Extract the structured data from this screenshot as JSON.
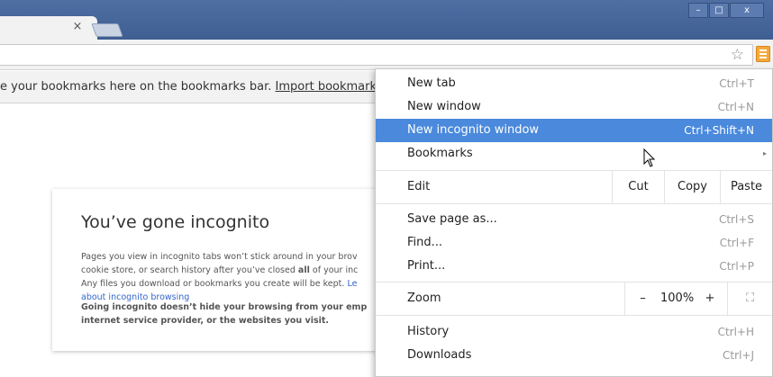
{
  "window": {
    "minimize": "–",
    "maximize": "□",
    "close": "x"
  },
  "tab": {
    "close": "×"
  },
  "bookmarks_bar": {
    "text": "e your bookmarks here on the bookmarks bar.",
    "import_link": "Import bookmark"
  },
  "incognito_page": {
    "title": "You’ve gone incognito",
    "para1_line1": "Pages you view in incognito tabs won’t stick around in your brov",
    "para1_line2": "cookie store, or search history after you’ve closed",
    "para1_bold": "all",
    "para1_line2b": "of your inc",
    "para1_line3": "Any files you download or bookmarks you create will be kept.",
    "para1_link1": "Le",
    "para1_link2": "about incognito browsing",
    "para2_line1": "Going incognito doesn’t hide your browsing from your emp",
    "para2_line2": "internet service provider, or the websites you visit."
  },
  "menu": {
    "new_tab": {
      "label": "New tab",
      "shortcut": "Ctrl+T"
    },
    "new_window": {
      "label": "New window",
      "shortcut": "Ctrl+N"
    },
    "new_incognito": {
      "label": "New incognito window",
      "shortcut": "Ctrl+Shift+N"
    },
    "bookmarks": {
      "label": "Bookmarks",
      "arrow": "▸"
    },
    "edit": {
      "label": "Edit",
      "cut": "Cut",
      "copy": "Copy",
      "paste": "Paste"
    },
    "save_page": {
      "label": "Save page as...",
      "shortcut": "Ctrl+S"
    },
    "find": {
      "label": "Find...",
      "shortcut": "Ctrl+F"
    },
    "print": {
      "label": "Print...",
      "shortcut": "Ctrl+P"
    },
    "zoom": {
      "label": "Zoom",
      "minus": "–",
      "level": "100%",
      "plus": "+",
      "fullscreen": "⛶"
    },
    "history": {
      "label": "History",
      "shortcut": "Ctrl+H"
    },
    "downloads": {
      "label": "Downloads",
      "shortcut": "Ctrl+J"
    }
  },
  "colors": {
    "titlebar": "#4f6fa3",
    "highlight": "#4a89dc",
    "menu_button": "#f4a93a"
  }
}
